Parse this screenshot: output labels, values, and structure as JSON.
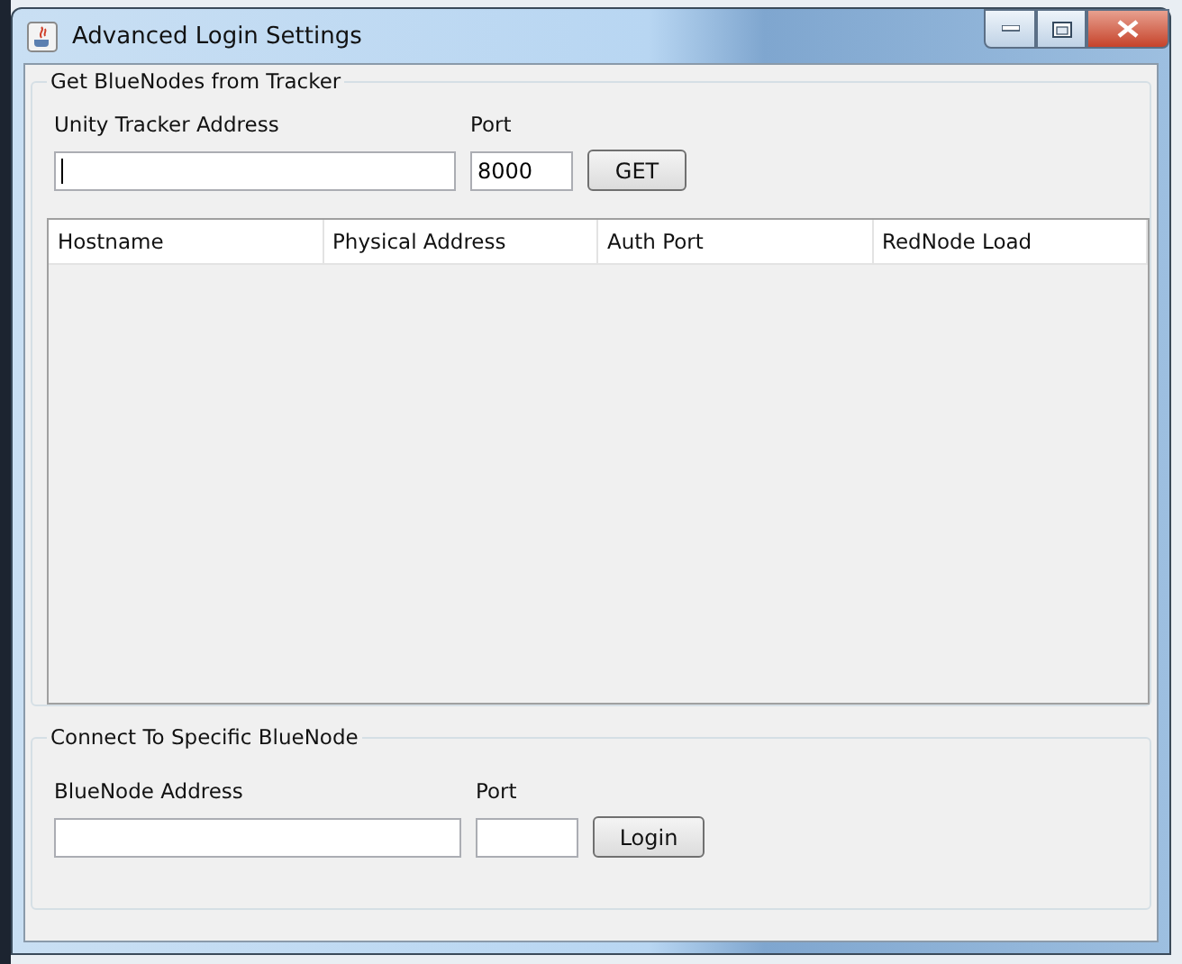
{
  "window": {
    "title": "Advanced Login Settings"
  },
  "tracker_group": {
    "title": "Get BlueNodes from Tracker",
    "address_label": "Unity Tracker Address",
    "port_label": "Port",
    "port_value": "8000",
    "button": "GET"
  },
  "table": {
    "columns": [
      "Hostname",
      "Physical Address",
      "Auth Port",
      "RedNode Load"
    ]
  },
  "connect_group": {
    "title": "Connect To Specific BlueNode",
    "address_label": "BlueNode Address",
    "port_label": "Port",
    "button": "Login"
  }
}
